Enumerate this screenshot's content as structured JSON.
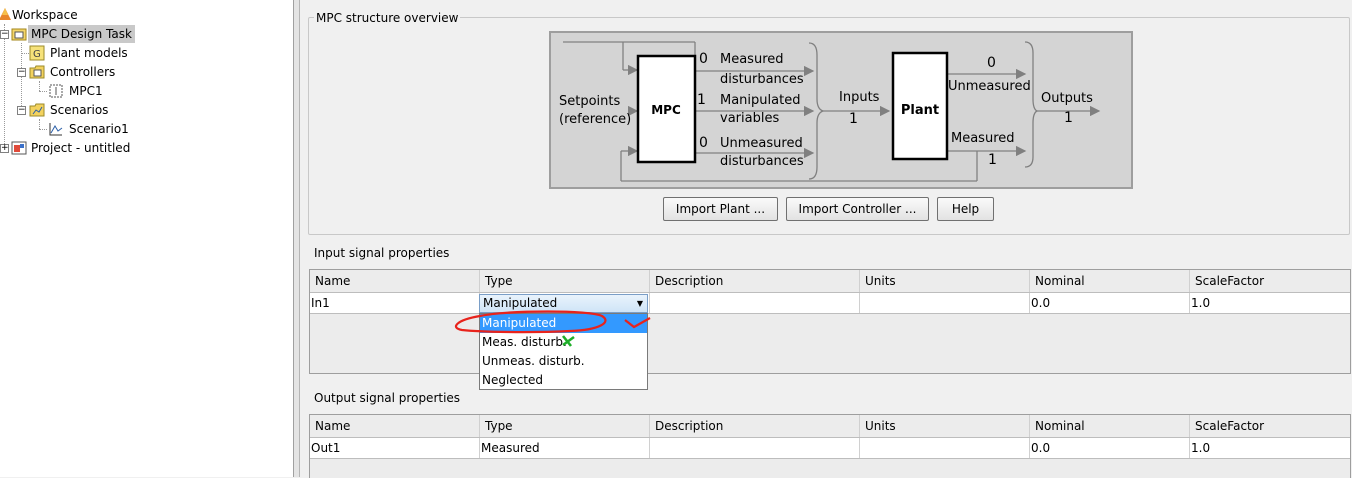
{
  "tree": {
    "items": [
      {
        "label": "Workspace",
        "icon": "matlab-logo-icon"
      },
      {
        "label": "MPC Design Task",
        "icon": "mpc-task-icon"
      },
      {
        "label": "Plant models",
        "icon": "plant-models-icon"
      },
      {
        "label": "Controllers",
        "icon": "controllers-folder-icon"
      },
      {
        "label": "MPC1",
        "icon": "controller-icon"
      },
      {
        "label": "Scenarios",
        "icon": "scenarios-folder-icon"
      },
      {
        "label": "Scenario1",
        "icon": "scenario-plot-icon"
      },
      {
        "label": "Project - untitled",
        "icon": "project-icon"
      }
    ],
    "selected": "MPC Design Task"
  },
  "overview": {
    "title": "MPC structure overview",
    "diagram": {
      "setpoints_line1": "Setpoints",
      "setpoints_line2": "(reference)",
      "mpc_label": "MPC",
      "plant_label": "Plant",
      "md_count": "0",
      "md_line1": "Measured",
      "md_line2": "disturbances",
      "mv_count": "1",
      "mv_line1": "Manipulated",
      "mv_line2": "variables",
      "ud_count": "0",
      "ud_line1": "Unmeasured",
      "ud_line2": "disturbances",
      "inputs_label": "Inputs",
      "inputs_count": "1",
      "unmeasured_count": "0",
      "unmeasured_label": "Unmeasured",
      "measured_label": "Measured",
      "measured_count": "1",
      "outputs_label": "Outputs",
      "outputs_count": "1"
    },
    "buttons": {
      "import_plant": "Import Plant ...",
      "import_controller": "Import Controller ...",
      "help": "Help"
    }
  },
  "input_signals": {
    "title": "Input signal properties",
    "columns": [
      "Name",
      "Type",
      "Description",
      "Units",
      "Nominal",
      "ScaleFactor"
    ],
    "rows": [
      {
        "name": "In1",
        "type": "Manipulated",
        "description": "",
        "units": "",
        "nominal": "0.0",
        "scale": "1.0"
      }
    ],
    "type_options": [
      "Manipulated",
      "Meas. disturb.",
      "Unmeas. disturb.",
      "Neglected"
    ],
    "selected_option": "Manipulated"
  },
  "output_signals": {
    "title": "Output signal properties",
    "columns": [
      "Name",
      "Type",
      "Description",
      "Units",
      "Nominal",
      "ScaleFactor"
    ],
    "rows": [
      {
        "name": "Out1",
        "type": "Measured",
        "description": "",
        "units": "",
        "nominal": "0.0",
        "scale": "1.0"
      }
    ]
  },
  "colors": {
    "annotation_red": "#e8231c",
    "annotation_green": "#1fae2a",
    "selection_blue": "#3399ff"
  }
}
